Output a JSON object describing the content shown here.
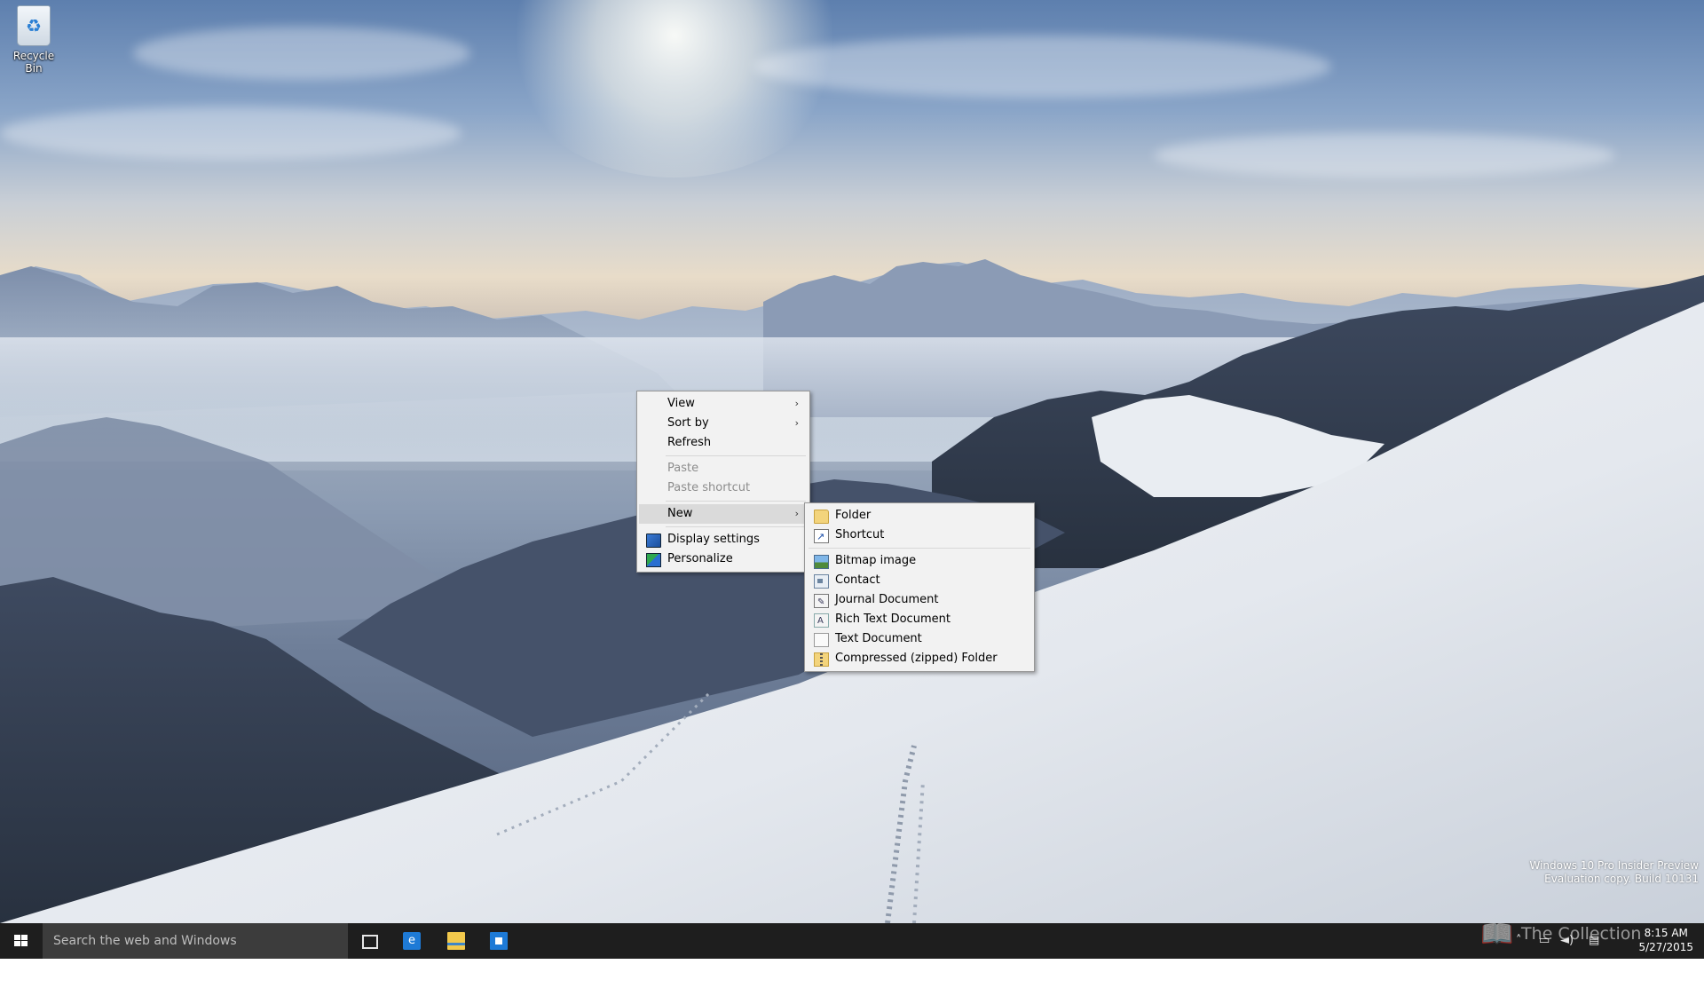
{
  "desktop": {
    "icons": [
      {
        "label": "Recycle Bin"
      }
    ]
  },
  "context_menu": {
    "items": [
      {
        "label": "View",
        "has_submenu": true
      },
      {
        "label": "Sort by",
        "has_submenu": true
      },
      {
        "label": "Refresh"
      },
      {
        "label": "Paste",
        "disabled": true
      },
      {
        "label": "Paste shortcut",
        "disabled": true
      },
      {
        "label": "New",
        "has_submenu": true,
        "highlighted": true
      },
      {
        "label": "Display settings",
        "icon": "display-settings-icon"
      },
      {
        "label": "Personalize",
        "icon": "personalize-icon"
      }
    ],
    "submenu_arrow": "›"
  },
  "new_submenu": {
    "items": [
      {
        "label": "Folder",
        "icon": "folder-icon"
      },
      {
        "label": "Shortcut",
        "icon": "shortcut-icon"
      },
      {
        "label": "Bitmap image",
        "icon": "bitmap-icon"
      },
      {
        "label": "Contact",
        "icon": "contact-icon"
      },
      {
        "label": "Journal Document",
        "icon": "journal-icon"
      },
      {
        "label": "Rich Text Document",
        "icon": "rich-text-icon"
      },
      {
        "label": "Text Document",
        "icon": "text-document-icon"
      },
      {
        "label": "Compressed (zipped) Folder",
        "icon": "zip-folder-icon"
      }
    ]
  },
  "watermark": {
    "line1": "Windows 10 Pro Insider Preview",
    "line2": "Evaluation copy. Build 10131",
    "overlay_logo": "The Collection Book"
  },
  "taskbar": {
    "search_placeholder": "Search the web and Windows",
    "pinned": [
      {
        "name": "task-view",
        "icon": "task-view-icon"
      },
      {
        "name": "edge",
        "icon": "edge-icon"
      },
      {
        "name": "file-explorer",
        "icon": "file-explorer-icon"
      },
      {
        "name": "store",
        "icon": "store-icon"
      }
    ],
    "tray": {
      "time": "8:15 AM",
      "date": "5/27/2015"
    },
    "background": "#101010"
  }
}
